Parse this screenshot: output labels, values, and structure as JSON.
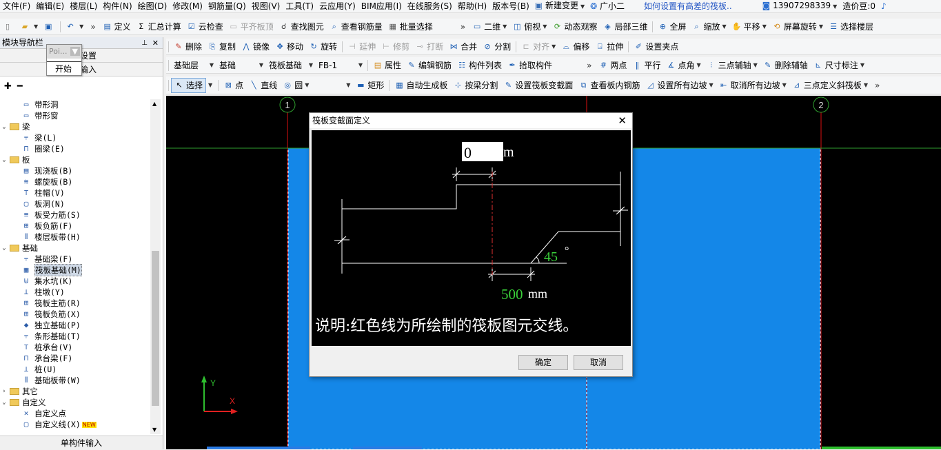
{
  "menubar": {
    "items": [
      "文件(F)",
      "编辑(E)",
      "楼层(L)",
      "构件(N)",
      "绘图(D)",
      "修改(M)",
      "钢筋量(Q)",
      "视图(V)",
      "工具(T)",
      "云应用(Y)",
      "BIM应用(I)",
      "在线服务(S)",
      "帮助(H)",
      "版本号(B)"
    ],
    "new_change": "新建变更",
    "user_name": "广小二",
    "help_link": "如何设置有高差的筏板..",
    "phone": "13907298339",
    "cost_bean": "造价豆:0"
  },
  "toolbar1": {
    "define": "定义",
    "calc": "汇总计算",
    "cloud_check": "云检查",
    "flush_board": "平齐板顶",
    "find": "查找图元",
    "view_rebar": "查看钢筋量",
    "batch_select": "批量选择",
    "view_mode": "二维",
    "top_view": "俯视",
    "dynamic_view": "动态观察",
    "local_3d": "局部三维",
    "fullscreen": "全屏",
    "zoom": "缩放",
    "pan": "平移",
    "rotate_screen": "屏幕旋转",
    "select_floor": "选择楼层"
  },
  "leftpanel": {
    "title": "模块导航栏",
    "tab_settings": "设置",
    "tab_input": "输入",
    "popup_title": "Poi...",
    "popup_start": "开始",
    "bottom": "单构件输入"
  },
  "tree": [
    {
      "level": 2,
      "label": "带形洞",
      "icon": "band-hole-icon"
    },
    {
      "level": 2,
      "label": "带形窗",
      "icon": "band-window-icon"
    },
    {
      "level": 1,
      "label": "梁",
      "folder": true
    },
    {
      "level": 2,
      "label": "梁(L)",
      "icon": "beam-icon"
    },
    {
      "level": 2,
      "label": "圈梁(E)",
      "icon": "ring-beam-icon"
    },
    {
      "level": 1,
      "label": "板",
      "folder": true
    },
    {
      "level": 2,
      "label": "现浇板(B)",
      "icon": "cast-slab-icon"
    },
    {
      "level": 2,
      "label": "螺旋板(B)",
      "icon": "spiral-slab-icon"
    },
    {
      "level": 2,
      "label": "柱帽(V)",
      "icon": "column-cap-icon"
    },
    {
      "level": 2,
      "label": "板洞(N)",
      "icon": "slab-hole-icon"
    },
    {
      "level": 2,
      "label": "板受力筋(S)",
      "icon": "slab-rebar-icon"
    },
    {
      "level": 2,
      "label": "板负筋(F)",
      "icon": "slab-neg-rebar-icon"
    },
    {
      "level": 2,
      "label": "楼层板带(H)",
      "icon": "floor-strip-icon"
    },
    {
      "level": 1,
      "label": "基础",
      "folder": true
    },
    {
      "level": 2,
      "label": "基础梁(F)",
      "icon": "foundation-beam-icon"
    },
    {
      "level": 2,
      "label": "筏板基础(M)",
      "icon": "raft-foundation-icon",
      "selected": true
    },
    {
      "level": 2,
      "label": "集水坑(K)",
      "icon": "sump-icon"
    },
    {
      "level": 2,
      "label": "柱墩(Y)",
      "icon": "column-pier-icon"
    },
    {
      "level": 2,
      "label": "筏板主筋(R)",
      "icon": "raft-main-rebar-icon"
    },
    {
      "level": 2,
      "label": "筏板负筋(X)",
      "icon": "raft-neg-rebar-icon"
    },
    {
      "level": 2,
      "label": "独立基础(P)",
      "icon": "isolated-footing-icon"
    },
    {
      "level": 2,
      "label": "条形基础(T)",
      "icon": "strip-footing-icon"
    },
    {
      "level": 2,
      "label": "桩承台(V)",
      "icon": "pile-cap-icon"
    },
    {
      "level": 2,
      "label": "承台梁(F)",
      "icon": "cap-beam-icon"
    },
    {
      "level": 2,
      "label": "桩(U)",
      "icon": "pile-icon"
    },
    {
      "level": 2,
      "label": "基础板带(W)",
      "icon": "foundation-strip-icon"
    },
    {
      "level": 1,
      "label": "其它",
      "folder": true,
      "collapsed": true
    },
    {
      "level": 1,
      "label": "自定义",
      "folder": true
    },
    {
      "level": 2,
      "label": "自定义点",
      "icon": "custom-point-icon"
    },
    {
      "level": 2,
      "label": "自定义线(X)",
      "icon": "custom-line-icon",
      "new": "NEW"
    }
  ],
  "toolbar2": {
    "delete": "删除",
    "copy": "复制",
    "mirror": "镜像",
    "move": "移动",
    "rotate": "旋转",
    "extend": "延伸",
    "trim": "修剪",
    "break": "打断",
    "merge": "合并",
    "split": "分割",
    "align": "对齐",
    "offset": "偏移",
    "stretch": "拉伸",
    "set_pinch": "设置夹点"
  },
  "toolbar3": {
    "floor": "基础层",
    "category": "基础",
    "type": "筏板基础",
    "component": "FB-1",
    "properties": "属性",
    "edit_rebar": "编辑钢筋",
    "component_list": "构件列表",
    "pick_component": "拾取构件",
    "two_point": "两点",
    "parallel": "平行",
    "point_angle": "点角",
    "three_point_axis": "三点辅轴",
    "delete_axis": "删除辅轴",
    "dimension": "尺寸标注"
  },
  "toolbar4": {
    "select": "选择",
    "point": "点",
    "line": "直线",
    "circle": "圆",
    "rect": "矩形",
    "auto_generate": "自动生成板",
    "split_by_beam": "按梁分割",
    "set_section": "设置筏板变截面",
    "view_rebar": "查看板内钢筋",
    "set_all_slopes": "设置所有边坡",
    "cancel_all_slopes": "取消所有边坡",
    "three_point_slope": "三点定义斜筏板"
  },
  "canvas": {
    "axis_1": "1",
    "axis_2": "2",
    "y_label": "Y",
    "x_label": "X",
    "slab_color": "#1487e8"
  },
  "dialog": {
    "title": "筏板变截面定义",
    "offset_value": "0",
    "offset_unit": "m",
    "angle_value": "45",
    "angle_unit": "°",
    "width_value": "500",
    "width_unit": "mm",
    "note": "说明:红色线为所绘制的筏板图元交线。",
    "ok": "确定",
    "cancel": "取消"
  }
}
